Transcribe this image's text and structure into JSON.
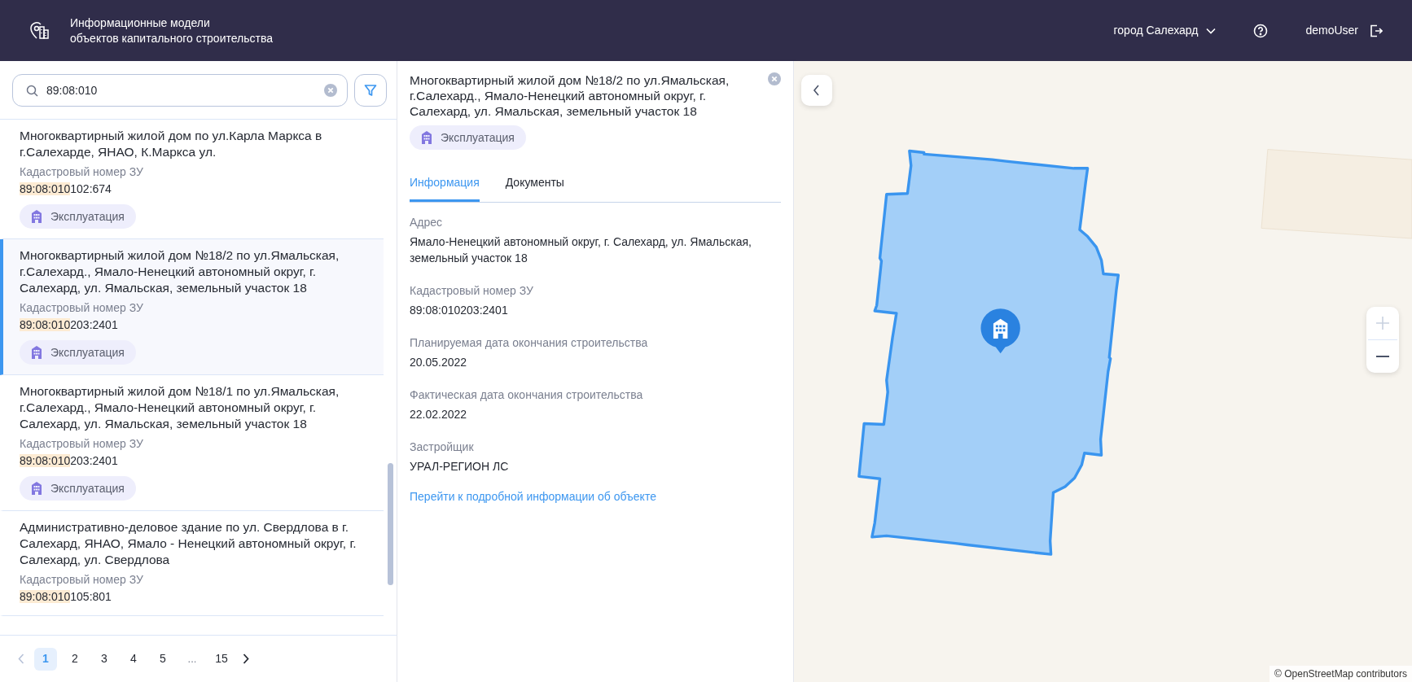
{
  "header": {
    "title": "Информационные модели\nобъектов капитального строительства",
    "city": "город Салехард",
    "user": "demoUser"
  },
  "search": {
    "value": "89:08:010"
  },
  "results": [
    {
      "title": "Многоквартирный жилой дом по ул.Карла Маркса в г.Салехарде, ЯНАО, К.Маркса ул.",
      "cadastral_label": "Кадастровый номер ЗУ",
      "cadastral_number": {
        "match": "89:08:010",
        "rest": "102:674"
      },
      "status": "Эксплуатация",
      "selected": false
    },
    {
      "title": "Многоквартирный жилой дом №18/2 по ул.Ямальская, г.Салехард., Ямало-Ненецкий автономный округ, г. Салехард, ул. Ямальская, земельный участок 18",
      "cadastral_label": "Кадастровый номер ЗУ",
      "cadastral_number": {
        "match": "89:08:010",
        "rest": "203:2401"
      },
      "status": "Эксплуатация",
      "selected": true
    },
    {
      "title": "Многоквартирный жилой дом №18/1 по ул.Ямальская, г.Салехард., Ямало-Ненецкий автономный округ, г. Салехард, ул. Ямальская, земельный участок 18",
      "cadastral_label": "Кадастровый номер ЗУ",
      "cadastral_number": {
        "match": "89:08:010",
        "rest": "203:2401"
      },
      "status": "Эксплуатация",
      "selected": false
    },
    {
      "title": "Административно-деловое здание по ул. Свердлова в г. Салехард, ЯНАО, Ямало - Ненецкий автономный округ, г. Салехард, ул. Свердлова",
      "cadastral_label": "Кадастровый номер ЗУ",
      "cadastral_number": {
        "match": "89:08:010",
        "rest": "105:801"
      },
      "selected": false
    }
  ],
  "pagination": {
    "prev_disabled": true,
    "pages": [
      {
        "label": "1",
        "kind": "page",
        "selected": true
      },
      {
        "label": "2",
        "kind": "page",
        "selected": false
      },
      {
        "label": "3",
        "kind": "page",
        "selected": false
      },
      {
        "label": "4",
        "kind": "page",
        "selected": false
      },
      {
        "label": "5",
        "kind": "page",
        "selected": false
      },
      {
        "label": "...",
        "kind": "ellipsis"
      },
      {
        "label": "15",
        "kind": "page",
        "selected": false
      }
    ]
  },
  "detail": {
    "title": "Многоквартирный жилой дом №18/2 по ул.Ямальская, г.Салехард., Ямало-Ненецкий автономный округ, г. Салехард, ул. Ямальская, земельный участок 18",
    "status": "Эксплуатация",
    "tabs": [
      {
        "label": "Информация",
        "selected": true
      },
      {
        "label": "Документы",
        "selected": false
      }
    ],
    "fields": [
      {
        "label": "Адрес",
        "value": "Ямало-Ненецкий автономный округ, г. Салехард, ул. Ямальская, земельный участок 18"
      },
      {
        "label": "Кадастровый номер ЗУ",
        "value": "89:08:010203:2401"
      },
      {
        "label": "Планируемая дата окончания строительства",
        "value": "20.05.2022"
      },
      {
        "label": "Фактическая дата окончания строительства",
        "value": "22.02.2022"
      },
      {
        "label": "Застройщик",
        "value": "УРАЛ-РЕГИОН ЛС"
      }
    ],
    "link": "Перейти к подробной информации об объекте"
  },
  "map": {
    "attribution": "© OpenStreetMap contributors",
    "zoom_in_disabled": true
  }
}
